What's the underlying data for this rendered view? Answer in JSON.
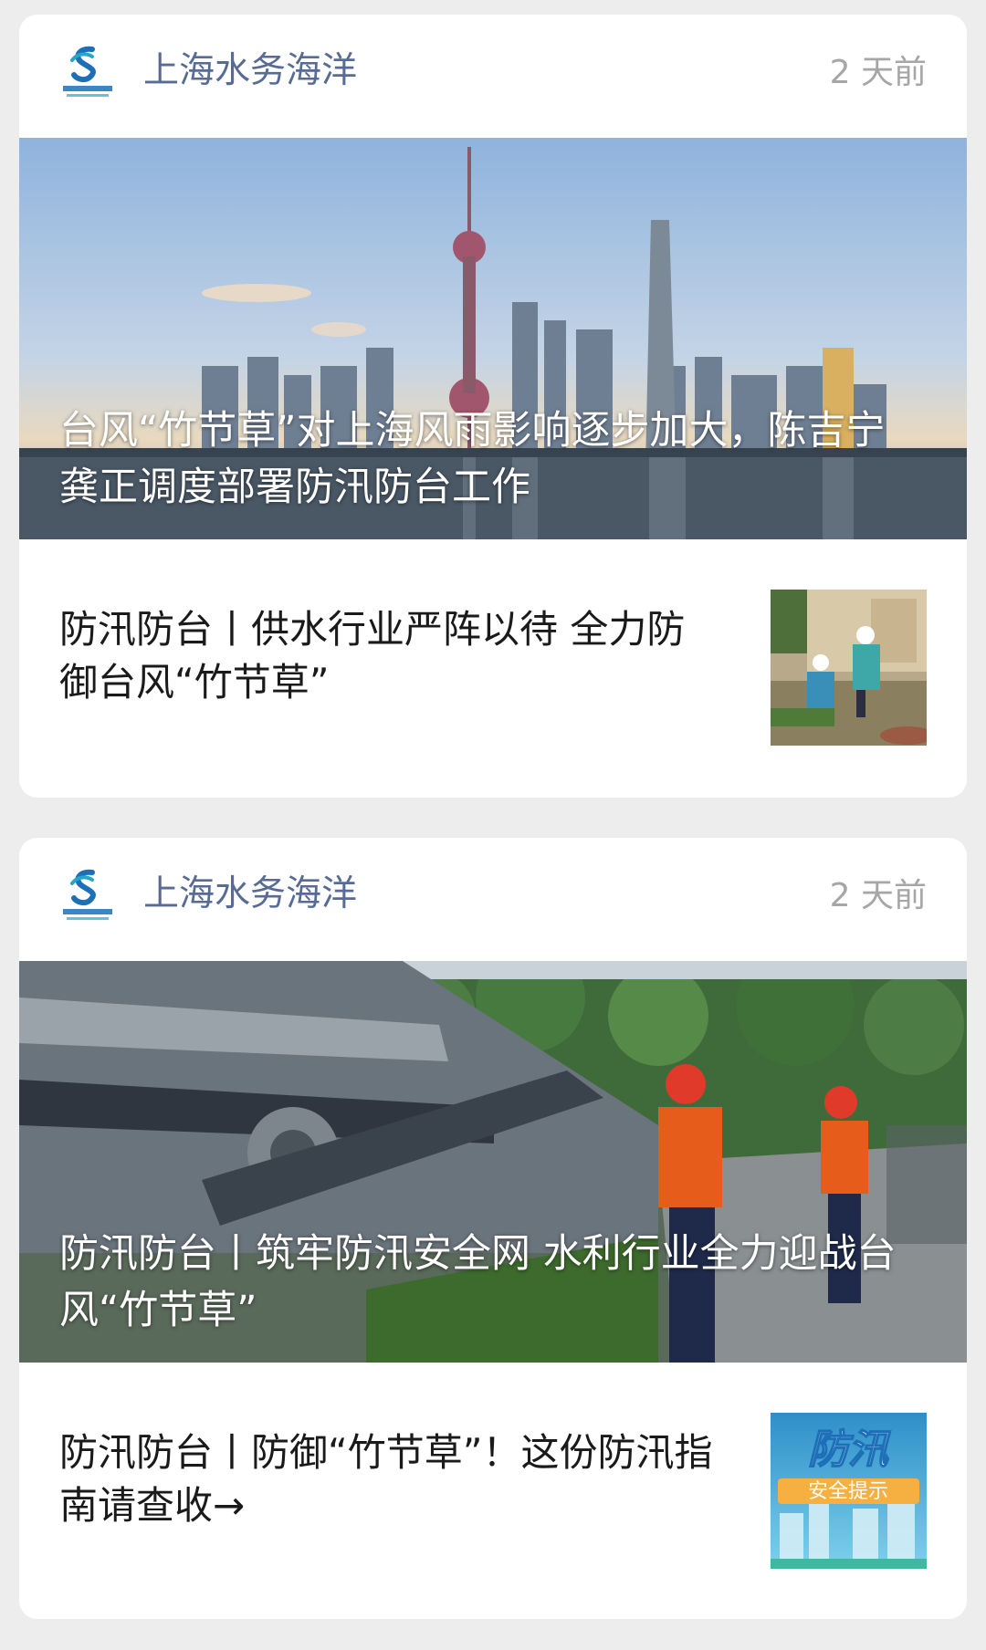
{
  "feed": {
    "cards": [
      {
        "source_name": "上海水务海洋",
        "time": "2 天前",
        "hero_title": "台风“竹节草”对上海风雨影响逐步加大，陈吉宁龚正调度部署防汛防台工作",
        "sub_title": "防汛防台丨供水行业严阵以待 全力防御台风“竹节草”"
      },
      {
        "source_name": "上海水务海洋",
        "time": "2 天前",
        "hero_title": "防汛防台丨筑牢防汛安全网 水利行业全力迎战台风“竹节草”",
        "sub_title": "防汛防台丨防御“竹节草”！这份防汛指南请查收→",
        "thumb_text_main": "防汛",
        "thumb_text_sub": "安全提示"
      }
    ]
  },
  "colors": {
    "background": "#ededed",
    "card": "#ffffff",
    "source_name": "#576b95",
    "time": "#a6a6a6",
    "title": "#1a1a1a",
    "logo_blue": "#1d6fb8",
    "logo_teal": "#27a6c9"
  }
}
